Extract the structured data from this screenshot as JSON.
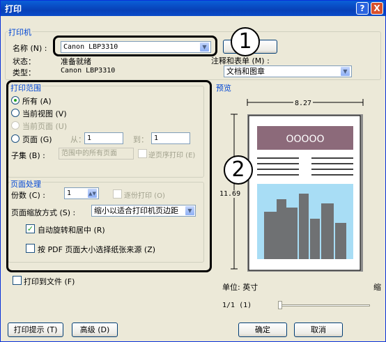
{
  "window": {
    "title": "打印"
  },
  "title_buttons": {
    "help": "?",
    "close": "X"
  },
  "printer": {
    "group": "打印机",
    "name_label": "名称 (N) :",
    "name_value": "Canon LBP3310",
    "status_label": "状态：",
    "status_value": "准备就绪",
    "type_label": "类型：",
    "type_value": "Canon LBP3310",
    "comments_label": "注释和表单 (M) :",
    "comments_value": "文档和图章"
  },
  "range": {
    "group": "打印范围",
    "all": "所有 (A)",
    "current_view": "当前视图 (V)",
    "current_page": "当前页面 (U)",
    "pages": "页面 (G)",
    "from_label": "从：",
    "from_value": "1",
    "to_label": "到：",
    "to_value": "1",
    "subset_label": "子集 (B) :",
    "subset_value": "范围中的所有页面",
    "reverse": "逆页序打印 (E)"
  },
  "handling": {
    "group": "页面处理",
    "copies_label": "份数 (C) :",
    "copies_value": "1",
    "collate": "逐份打印 (O)",
    "scaling_label": "页面缩放方式 (S) :",
    "scaling_value": "缩小以适合打印机页边距",
    "auto_rotate": "自动旋转和居中 (R)",
    "pdf_size": "按 PDF 页面大小选择纸张来源 (Z)"
  },
  "print_to_file": "打印到文件 (F)",
  "preview": {
    "group": "预览",
    "width": "8.27",
    "height": "11.69",
    "units": "单位: 英寸",
    "zoom": "缩",
    "page": "1/1  (1)",
    "banner_text": "OOOOO"
  },
  "buttons": {
    "tips": "打印提示 (T)",
    "advanced": "高级 (D)",
    "ok": "确定",
    "cancel": "取消"
  },
  "callouts": {
    "one": "1",
    "two": "2"
  },
  "colors": {
    "accent": "#0046d5",
    "title_bar": "#0a4ac8",
    "banner": "#8c6a7a",
    "sky": "#a8ddf5"
  }
}
